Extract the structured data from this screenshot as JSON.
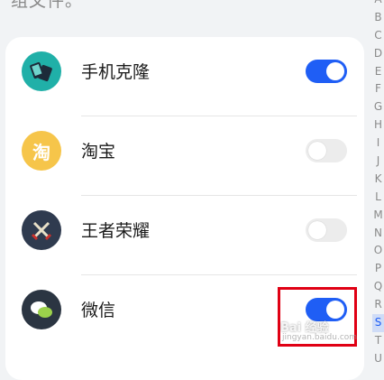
{
  "top_partial_text": "组文件。",
  "apps": [
    {
      "name": "手机克隆",
      "icon": "phone-clone-icon",
      "enabled": true
    },
    {
      "name": "淘宝",
      "icon": "taobao-icon",
      "icon_char": "淘",
      "enabled": false
    },
    {
      "name": "王者荣耀",
      "icon": "honor-of-kings-icon",
      "enabled": false
    },
    {
      "name": "微信",
      "icon": "wechat-icon",
      "enabled": true
    }
  ],
  "index_letters": [
    "A",
    "B",
    "C",
    "D",
    "E",
    "F",
    "G",
    "H",
    "I",
    "J",
    "K",
    "L",
    "M",
    "N",
    "O",
    "P",
    "Q",
    "R",
    "S",
    "T",
    "U"
  ],
  "active_index_letter": "S",
  "watermark": {
    "text": "Bai 经验",
    "url": "jingyan.baidu.com"
  },
  "colors": {
    "accent": "#1f5ef5",
    "highlight_box": "#e00014"
  }
}
